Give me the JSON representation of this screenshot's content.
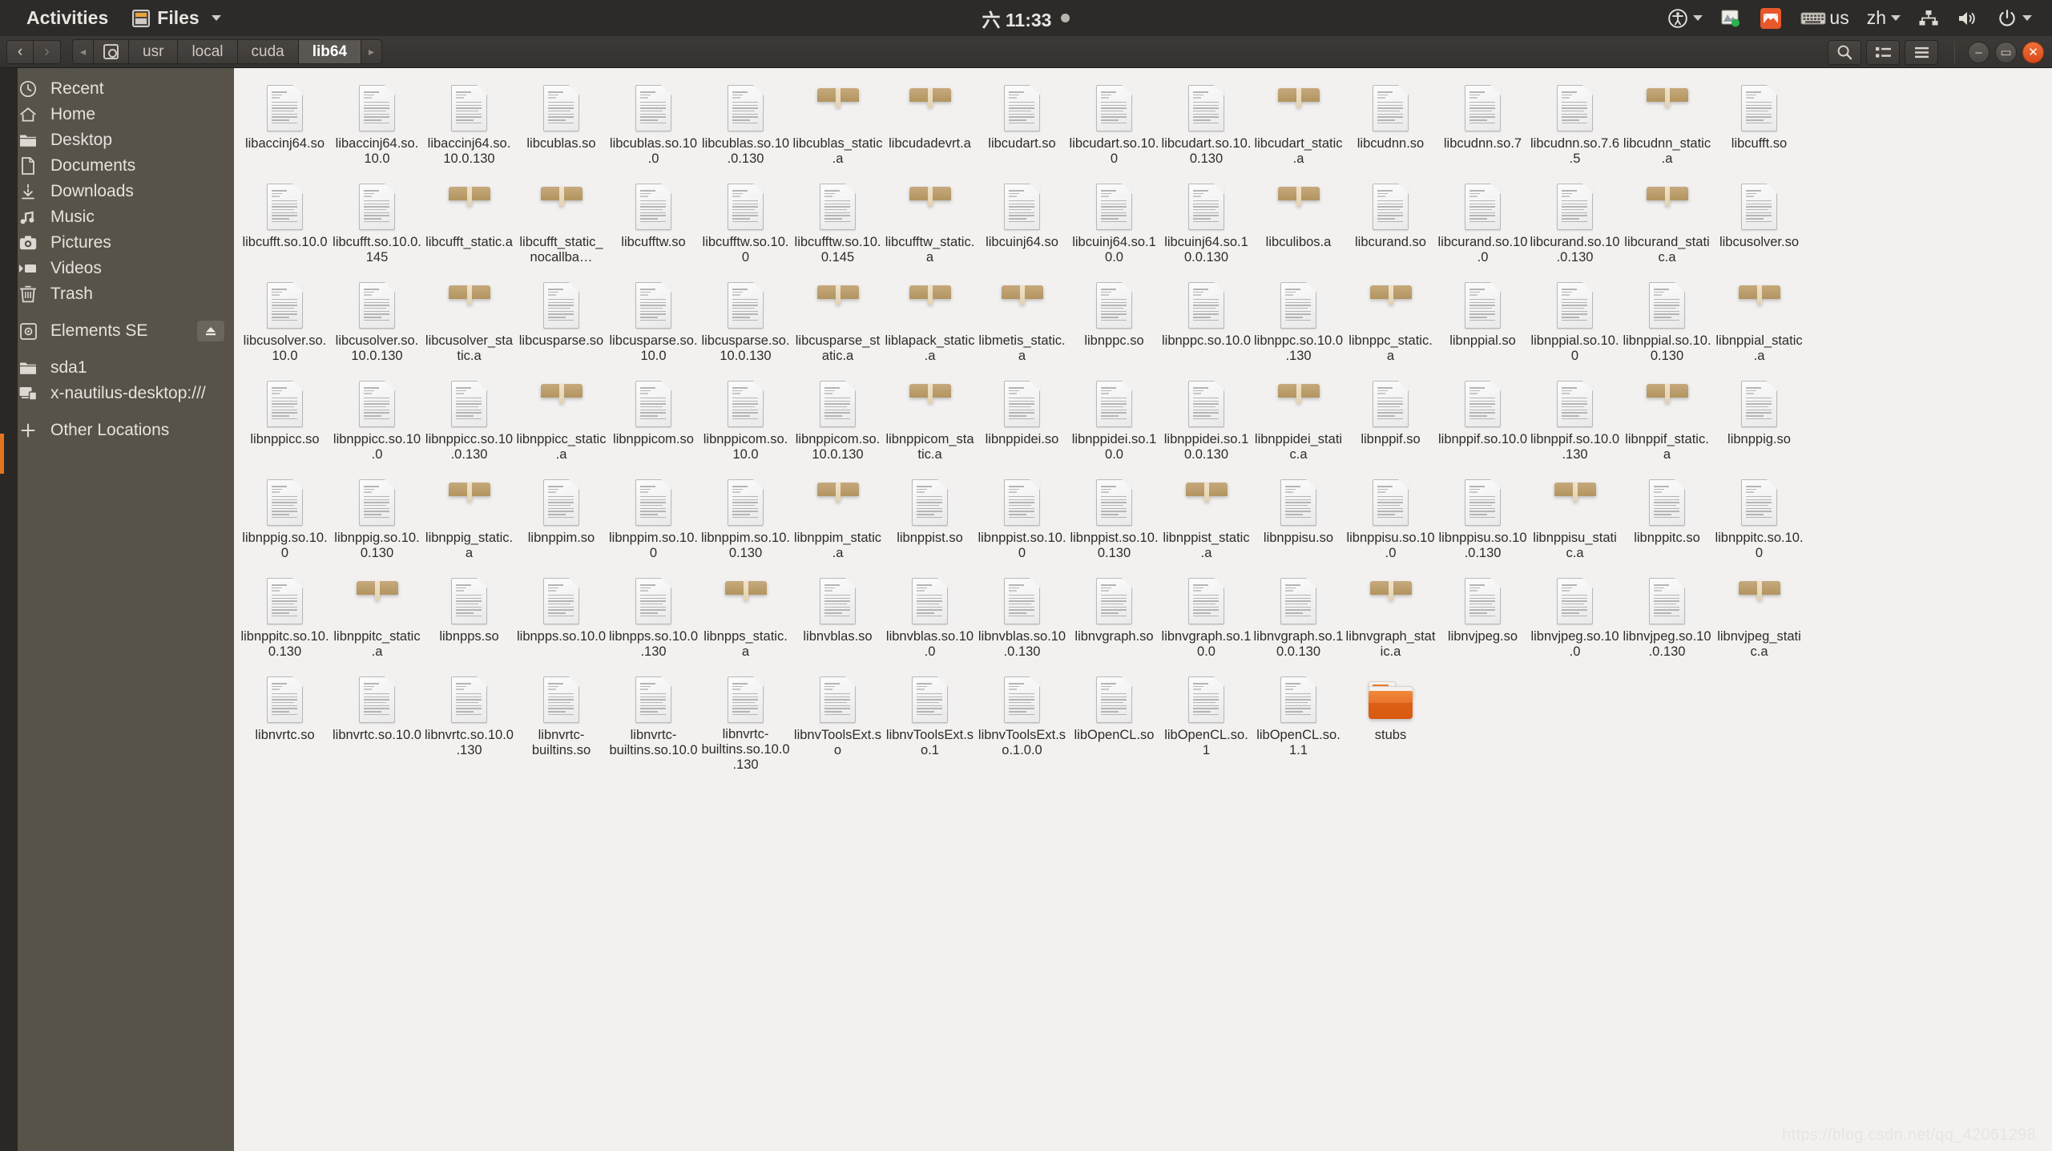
{
  "topbar": {
    "activities": "Activities",
    "app_name": "Files",
    "clock": "六 11:33",
    "indicators": {
      "accessibility": "accessibility-icon",
      "display": "display-icon",
      "mail": "mail-icon",
      "keyboard_layout": "us",
      "input_method": "zh",
      "network": "network-icon",
      "volume": "volume-icon",
      "power": "power-icon"
    }
  },
  "headerbar": {
    "back": "‹",
    "forward": "›",
    "crumb_prev": "◂",
    "crumb_next": "▸",
    "breadcrumbs": [
      {
        "label": "usr",
        "active": false
      },
      {
        "label": "local",
        "active": false
      },
      {
        "label": "cuda",
        "active": false
      },
      {
        "label": "lib64",
        "active": true
      }
    ],
    "search_icon": "search-icon",
    "view_icon": "list-view-icon",
    "menu_icon": "hamburger-menu-icon",
    "window_buttons": {
      "minimize": "–",
      "maximize": "▭",
      "close": "✕"
    }
  },
  "sidebar": {
    "items": [
      {
        "label": "Recent",
        "icon": "clock-icon",
        "eject": false
      },
      {
        "label": "Home",
        "icon": "home-icon",
        "eject": false
      },
      {
        "label": "Desktop",
        "icon": "folder-icon",
        "eject": false
      },
      {
        "label": "Documents",
        "icon": "document-icon",
        "eject": false
      },
      {
        "label": "Downloads",
        "icon": "download-icon",
        "eject": false
      },
      {
        "label": "Music",
        "icon": "music-icon",
        "eject": false
      },
      {
        "label": "Pictures",
        "icon": "camera-icon",
        "eject": false
      },
      {
        "label": "Videos",
        "icon": "video-icon",
        "eject": false
      },
      {
        "label": "Trash",
        "icon": "trash-icon",
        "eject": false
      },
      {
        "label": "Elements SE",
        "icon": "drive-icon",
        "eject": true
      },
      {
        "label": "sda1",
        "icon": "folder-icon",
        "eject": false
      },
      {
        "label": "x-nautilus-desktop:///",
        "icon": "desktop-icon",
        "eject": false
      },
      {
        "label": "Other Locations",
        "icon": "plus-icon",
        "eject": false
      }
    ]
  },
  "files": [
    {
      "name": "libaccinj64.so",
      "type": "document"
    },
    {
      "name": "libaccinj64.so.10.0",
      "type": "document"
    },
    {
      "name": "libaccinj64.so.10.0.130",
      "type": "document"
    },
    {
      "name": "libcublas.so",
      "type": "document"
    },
    {
      "name": "libcublas.so.10.0",
      "type": "document"
    },
    {
      "name": "libcublas.so.10.0.130",
      "type": "document"
    },
    {
      "name": "libcublas_static.a",
      "type": "archive"
    },
    {
      "name": "libcudadevrt.a",
      "type": "archive"
    },
    {
      "name": "libcudart.so",
      "type": "document"
    },
    {
      "name": "libcudart.so.10.0",
      "type": "document"
    },
    {
      "name": "libcudart.so.10.0.130",
      "type": "document"
    },
    {
      "name": "libcudart_static.a",
      "type": "archive"
    },
    {
      "name": "libcudnn.so",
      "type": "document"
    },
    {
      "name": "libcudnn.so.7",
      "type": "document"
    },
    {
      "name": "libcudnn.so.7.6.5",
      "type": "document"
    },
    {
      "name": "libcudnn_static.a",
      "type": "archive"
    },
    {
      "name": "libcufft.so",
      "type": "document"
    },
    {
      "name": "libcufft.so.10.0",
      "type": "document"
    },
    {
      "name": "libcufft.so.10.0.145",
      "type": "document"
    },
    {
      "name": "libcufft_static.a",
      "type": "archive"
    },
    {
      "name": "libcufft_static_nocallba…",
      "type": "archive"
    },
    {
      "name": "libcufftw.so",
      "type": "document"
    },
    {
      "name": "libcufftw.so.10.0",
      "type": "document"
    },
    {
      "name": "libcufftw.so.10.0.145",
      "type": "document"
    },
    {
      "name": "libcufftw_static.a",
      "type": "archive"
    },
    {
      "name": "libcuinj64.so",
      "type": "document"
    },
    {
      "name": "libcuinj64.so.10.0",
      "type": "document"
    },
    {
      "name": "libcuinj64.so.10.0.130",
      "type": "document"
    },
    {
      "name": "libculibos.a",
      "type": "archive"
    },
    {
      "name": "libcurand.so",
      "type": "document"
    },
    {
      "name": "libcurand.so.10.0",
      "type": "document"
    },
    {
      "name": "libcurand.so.10.0.130",
      "type": "document"
    },
    {
      "name": "libcurand_static.a",
      "type": "archive"
    },
    {
      "name": "libcusolver.so",
      "type": "document"
    },
    {
      "name": "libcusolver.so.10.0",
      "type": "document"
    },
    {
      "name": "libcusolver.so.10.0.130",
      "type": "document"
    },
    {
      "name": "libcusolver_static.a",
      "type": "archive"
    },
    {
      "name": "libcusparse.so",
      "type": "document"
    },
    {
      "name": "libcusparse.so.10.0",
      "type": "document"
    },
    {
      "name": "libcusparse.so.10.0.130",
      "type": "document"
    },
    {
      "name": "libcusparse_static.a",
      "type": "archive"
    },
    {
      "name": "liblapack_static.a",
      "type": "archive"
    },
    {
      "name": "libmetis_static.a",
      "type": "archive"
    },
    {
      "name": "libnppc.so",
      "type": "document"
    },
    {
      "name": "libnppc.so.10.0",
      "type": "document"
    },
    {
      "name": "libnppc.so.10.0.130",
      "type": "document"
    },
    {
      "name": "libnppc_static.a",
      "type": "archive"
    },
    {
      "name": "libnppial.so",
      "type": "document"
    },
    {
      "name": "libnppial.so.10.0",
      "type": "document"
    },
    {
      "name": "libnppial.so.10.0.130",
      "type": "document"
    },
    {
      "name": "libnppial_static.a",
      "type": "archive"
    },
    {
      "name": "libnppicc.so",
      "type": "document"
    },
    {
      "name": "libnppicc.so.10.0",
      "type": "document"
    },
    {
      "name": "libnppicc.so.10.0.130",
      "type": "document"
    },
    {
      "name": "libnppicc_static.a",
      "type": "archive"
    },
    {
      "name": "libnppicom.so",
      "type": "document"
    },
    {
      "name": "libnppicom.so.10.0",
      "type": "document"
    },
    {
      "name": "libnppicom.so.10.0.130",
      "type": "document"
    },
    {
      "name": "libnppicom_static.a",
      "type": "archive"
    },
    {
      "name": "libnppidei.so",
      "type": "document"
    },
    {
      "name": "libnppidei.so.10.0",
      "type": "document"
    },
    {
      "name": "libnppidei.so.10.0.130",
      "type": "document"
    },
    {
      "name": "libnppidei_static.a",
      "type": "archive"
    },
    {
      "name": "libnppif.so",
      "type": "document"
    },
    {
      "name": "libnppif.so.10.0",
      "type": "document"
    },
    {
      "name": "libnppif.so.10.0.130",
      "type": "document"
    },
    {
      "name": "libnppif_static.a",
      "type": "archive"
    },
    {
      "name": "libnppig.so",
      "type": "document"
    },
    {
      "name": "libnppig.so.10.0",
      "type": "document"
    },
    {
      "name": "libnppig.so.10.0.130",
      "type": "document"
    },
    {
      "name": "libnppig_static.a",
      "type": "archive"
    },
    {
      "name": "libnppim.so",
      "type": "document"
    },
    {
      "name": "libnppim.so.10.0",
      "type": "document"
    },
    {
      "name": "libnppim.so.10.0.130",
      "type": "document"
    },
    {
      "name": "libnppim_static.a",
      "type": "archive"
    },
    {
      "name": "libnppist.so",
      "type": "document"
    },
    {
      "name": "libnppist.so.10.0",
      "type": "document"
    },
    {
      "name": "libnppist.so.10.0.130",
      "type": "document"
    },
    {
      "name": "libnppist_static.a",
      "type": "archive"
    },
    {
      "name": "libnppisu.so",
      "type": "document"
    },
    {
      "name": "libnppisu.so.10.0",
      "type": "document"
    },
    {
      "name": "libnppisu.so.10.0.130",
      "type": "document"
    },
    {
      "name": "libnppisu_static.a",
      "type": "archive"
    },
    {
      "name": "libnppitc.so",
      "type": "document"
    },
    {
      "name": "libnppitc.so.10.0",
      "type": "document"
    },
    {
      "name": "libnppitc.so.10.0.130",
      "type": "document"
    },
    {
      "name": "libnppitc_static.a",
      "type": "archive"
    },
    {
      "name": "libnpps.so",
      "type": "document"
    },
    {
      "name": "libnpps.so.10.0",
      "type": "document"
    },
    {
      "name": "libnpps.so.10.0.130",
      "type": "document"
    },
    {
      "name": "libnpps_static.a",
      "type": "archive"
    },
    {
      "name": "libnvblas.so",
      "type": "document"
    },
    {
      "name": "libnvblas.so.10.0",
      "type": "document"
    },
    {
      "name": "libnvblas.so.10.0.130",
      "type": "document"
    },
    {
      "name": "libnvgraph.so",
      "type": "document"
    },
    {
      "name": "libnvgraph.so.10.0",
      "type": "document"
    },
    {
      "name": "libnvgraph.so.10.0.130",
      "type": "document"
    },
    {
      "name": "libnvgraph_static.a",
      "type": "archive"
    },
    {
      "name": "libnvjpeg.so",
      "type": "document"
    },
    {
      "name": "libnvjpeg.so.10.0",
      "type": "document"
    },
    {
      "name": "libnvjpeg.so.10.0.130",
      "type": "document"
    },
    {
      "name": "libnvjpeg_static.a",
      "type": "archive"
    },
    {
      "name": "libnvrtc.so",
      "type": "document"
    },
    {
      "name": "libnvrtc.so.10.0",
      "type": "document"
    },
    {
      "name": "libnvrtc.so.10.0.130",
      "type": "document"
    },
    {
      "name": "libnvrtc-builtins.so",
      "type": "document"
    },
    {
      "name": "libnvrtc-builtins.so.10.0",
      "type": "document"
    },
    {
      "name": "libnvrtc-builtins.so.10.0.130",
      "type": "document"
    },
    {
      "name": "libnvToolsExt.so",
      "type": "document"
    },
    {
      "name": "libnvToolsExt.so.1",
      "type": "document"
    },
    {
      "name": "libnvToolsExt.so.1.0.0",
      "type": "document"
    },
    {
      "name": "libOpenCL.so",
      "type": "document"
    },
    {
      "name": "libOpenCL.so.1",
      "type": "document"
    },
    {
      "name": "libOpenCL.so.1.1",
      "type": "document"
    },
    {
      "name": "stubs",
      "type": "folder"
    }
  ],
  "watermark": "https://blog.csdn.net/qq_42061298",
  "colors": {
    "topbar_bg": "#2d2b29",
    "sidebar_bg": "#575349",
    "content_bg": "#f2f1f0",
    "accent_orange": "#e2741f",
    "close_button": "#dd5b1f",
    "archive_box": "#c49a63",
    "folder_orange": "#e8742a"
  }
}
